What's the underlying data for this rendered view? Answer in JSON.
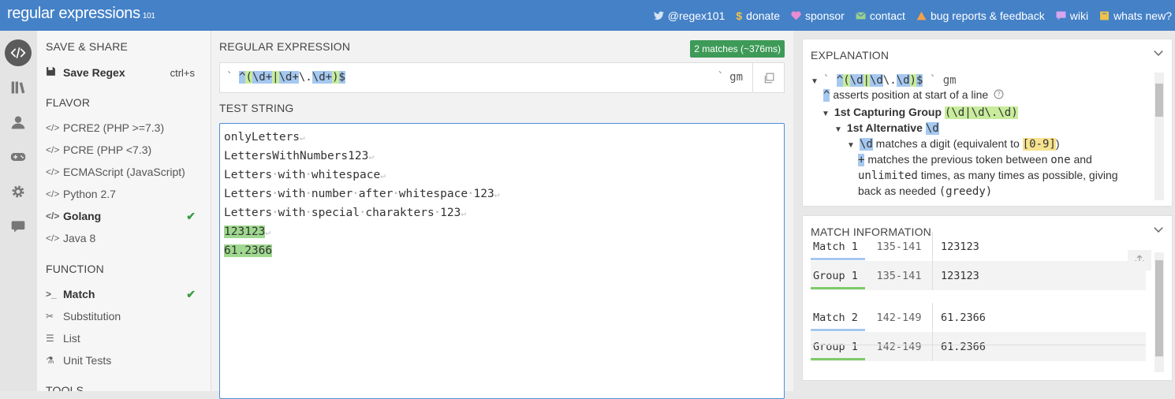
{
  "header": {
    "logo_main": "regular expressions",
    "logo_sub": "101",
    "links": [
      {
        "label": "@regex101",
        "icon": "twitter-icon"
      },
      {
        "label": "donate",
        "icon": "dollar-icon"
      },
      {
        "label": "sponsor",
        "icon": "heart-icon"
      },
      {
        "label": "contact",
        "icon": "mail-icon"
      },
      {
        "label": "bug reports & feedback",
        "icon": "warning-icon"
      },
      {
        "label": "wiki",
        "icon": "chat-icon"
      },
      {
        "label": "whats new?",
        "icon": "bookmark-icon"
      }
    ]
  },
  "left": {
    "save_share_title": "SAVE & SHARE",
    "save_label": "Save Regex",
    "save_shortcut": "ctrl+s",
    "flavor_title": "FLAVOR",
    "flavors": [
      "PCRE2 (PHP >=7.3)",
      "PCRE (PHP <7.3)",
      "ECMAScript (JavaScript)",
      "Python 2.7",
      "Golang",
      "Java 8"
    ],
    "selected_flavor": "Golang",
    "function_title": "FUNCTION",
    "functions": [
      "Match",
      "Substitution",
      "List",
      "Unit Tests"
    ],
    "selected_function": "Match",
    "tools_title": "TOOLS"
  },
  "main": {
    "regex_title": "REGULAR EXPRESSION",
    "match_badge": "2 matches (~376ms)",
    "delimiter": "`",
    "regex": "^(\\d+|\\d+\\.\\d+)$",
    "flags": "gm",
    "test_title": "TEST STRING",
    "test_lines": [
      "onlyLetters",
      "LettersWithNumbers123",
      "Letters with whitespace",
      "Letters with number after whitespace 123",
      "Letters with special charakters 123",
      "123123",
      "61.2366"
    ],
    "matched_lines": [
      5,
      6
    ]
  },
  "explanation": {
    "title": "EXPLANATION",
    "regex_display": "^(\\d|\\d\\.\\d)$",
    "flags": "gm",
    "line_anchor": "asserts position at start of a line",
    "group_label": "1st Capturing Group",
    "group_pattern": "(\\d|\\d\\.\\d)",
    "alt_label": "1st Alternative",
    "alt_pattern": "\\d",
    "digit_text": "matches a digit (equivalent to",
    "digit_range": "[0-9]",
    "plus_text_1": "matches the previous token between",
    "plus_one": "one",
    "plus_and": "and",
    "plus_unlimited": "unlimited",
    "plus_text_2": "times, as many times as possible, giving",
    "plus_text_3": "back as needed",
    "plus_greedy": "(greedy)"
  },
  "match_info": {
    "title": "MATCH INFORMATION",
    "rows": [
      {
        "label": "Match 1",
        "pos": "135-141",
        "value": "123123",
        "color": "#a5c8f0"
      },
      {
        "label": "Group 1",
        "pos": "135-141",
        "value": "123123",
        "color": "#7fca6a"
      },
      {
        "label": "Match 2",
        "pos": "142-149",
        "value": "61.2366",
        "color": "#a5c8f0"
      },
      {
        "label": "Group 1",
        "pos": "142-149",
        "value": "61.2366",
        "color": "#7fca6a"
      }
    ]
  },
  "colors": {
    "topbar": "#4481c7",
    "match_badge": "#3d9a57",
    "match_highlight": "#9fd88f"
  }
}
